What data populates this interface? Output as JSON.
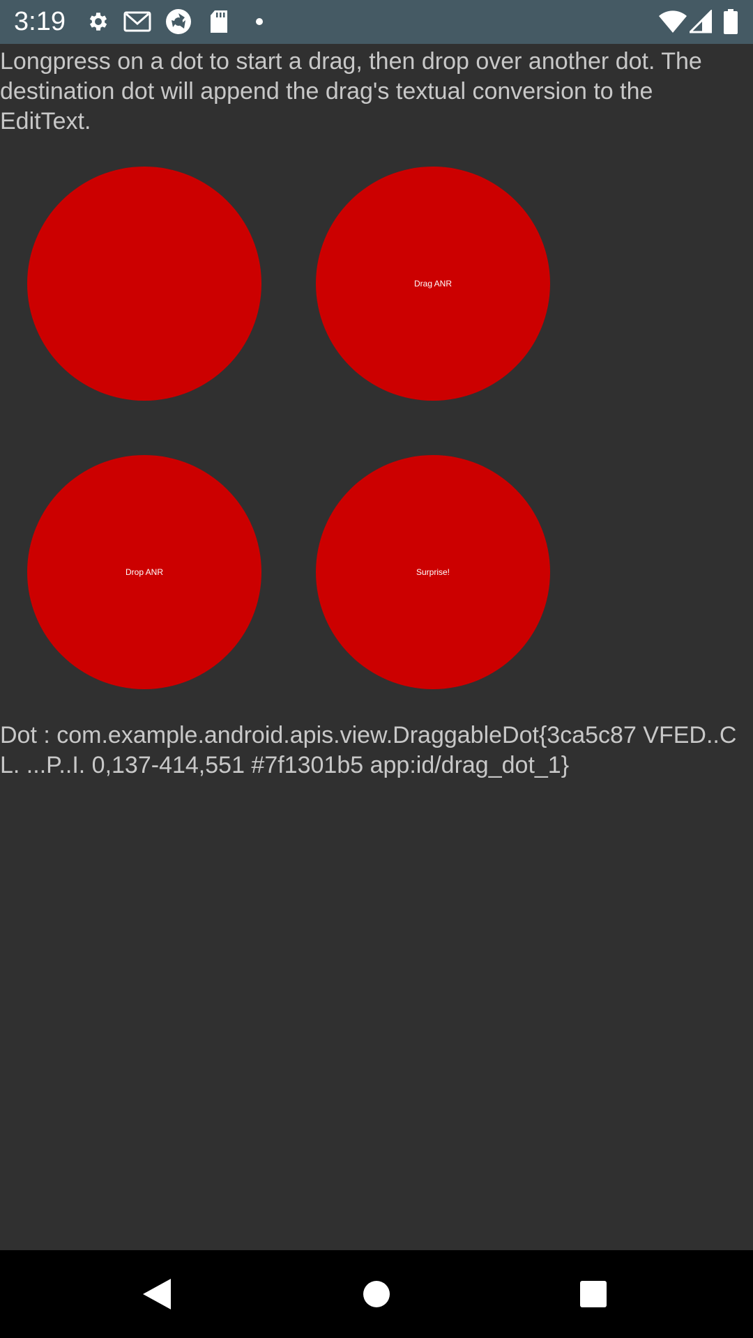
{
  "status_bar": {
    "time": "3:19",
    "left_icons": [
      "gear-icon",
      "gmail-icon",
      "camera-aperture-icon",
      "sd-card-icon",
      "dot-icon"
    ],
    "right_icons": [
      "wifi-icon",
      "cell-signal-icon",
      "battery-icon"
    ],
    "background": "#455a64"
  },
  "instructions": "Longpress on a dot to start a drag, then drop over another dot. The destination dot will append the drag's textual conversion to the EditText.",
  "dots": [
    {
      "label": ""
    },
    {
      "label": "Drag ANR"
    },
    {
      "label": "Drop ANR"
    },
    {
      "label": "Surprise!"
    }
  ],
  "dot_color": "#cc0000",
  "result_text": "Dot : com.example.android.apis.view.DraggableDot{3ca5c87 VFED..CL. ...P..I. 0,137-414,551 #7f1301b5 app:id/drag_dot_1}",
  "nav_bar": {
    "buttons": [
      "back-icon",
      "home-icon",
      "recents-icon"
    ]
  }
}
